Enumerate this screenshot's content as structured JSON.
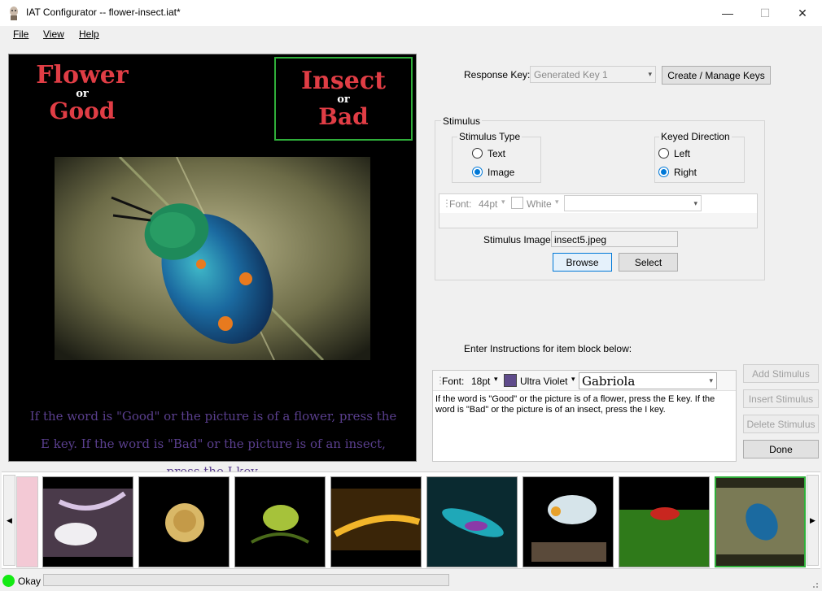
{
  "window": {
    "title": "IAT Configurator -- flower-insect.iat*",
    "minimize_glyph": "—",
    "maximize_glyph": "☐",
    "close_glyph": "✕"
  },
  "menu": {
    "file": "File",
    "view": "View",
    "help": "Help"
  },
  "preview": {
    "left_category": {
      "main": "Flower",
      "or": "or",
      "alt": "Good"
    },
    "right_category": {
      "main": "Insect",
      "or": "or",
      "alt": "Bad"
    },
    "instructions": "If the word is \"Good\" or the picture is of a flower, press the E key. If the word is \"Bad\" or the picture is of an insect, press the I key."
  },
  "response_key": {
    "label": "Response Key:",
    "value": "Generated Key 1",
    "manage_button": "Create / Manage Keys"
  },
  "stimulus": {
    "group_label": "Stimulus",
    "type_group": {
      "label": "Stimulus Type",
      "options": [
        "Text",
        "Image"
      ],
      "selected": "Image"
    },
    "direction_group": {
      "label": "Keyed Direction",
      "options": [
        "Left",
        "Right"
      ],
      "selected": "Right"
    },
    "font_toolbar": {
      "font_label": "Font:",
      "size": "44pt",
      "color_name": "White",
      "font_name": ""
    },
    "image_label": "Stimulus Image:",
    "image_value": "insect5.jpeg",
    "browse_button": "Browse",
    "select_button": "Select"
  },
  "instructions_editor": {
    "label": "Enter Instructions for item block below:",
    "font_label": "Font:",
    "size": "18pt",
    "color_name": "Ultra Violet",
    "color_hex": "#5f4b8b",
    "font_name": "Gabriola",
    "text": "If the word is \"Good\" or the picture is of a flower, press the E key. If the word is \"Bad\" or the picture is of an insect, press the I key."
  },
  "side_buttons": {
    "add": "Add Stimulus",
    "insert": "Insert Stimulus",
    "delete": "Delete Stimulus",
    "done": "Done"
  },
  "thumbnails": [
    "lily",
    "gold-rose",
    "green-rose",
    "golden-sparkles",
    "dragonfly",
    "colorful-insect",
    "shrimp-on-moss",
    "jewel-beetle"
  ],
  "status": {
    "text": "Okay",
    "color": "#13ea13"
  },
  "colors": {
    "accent_green": "#2fae3a",
    "category_red": "#e03d45",
    "instruction_violet": "#5a3f8e"
  }
}
